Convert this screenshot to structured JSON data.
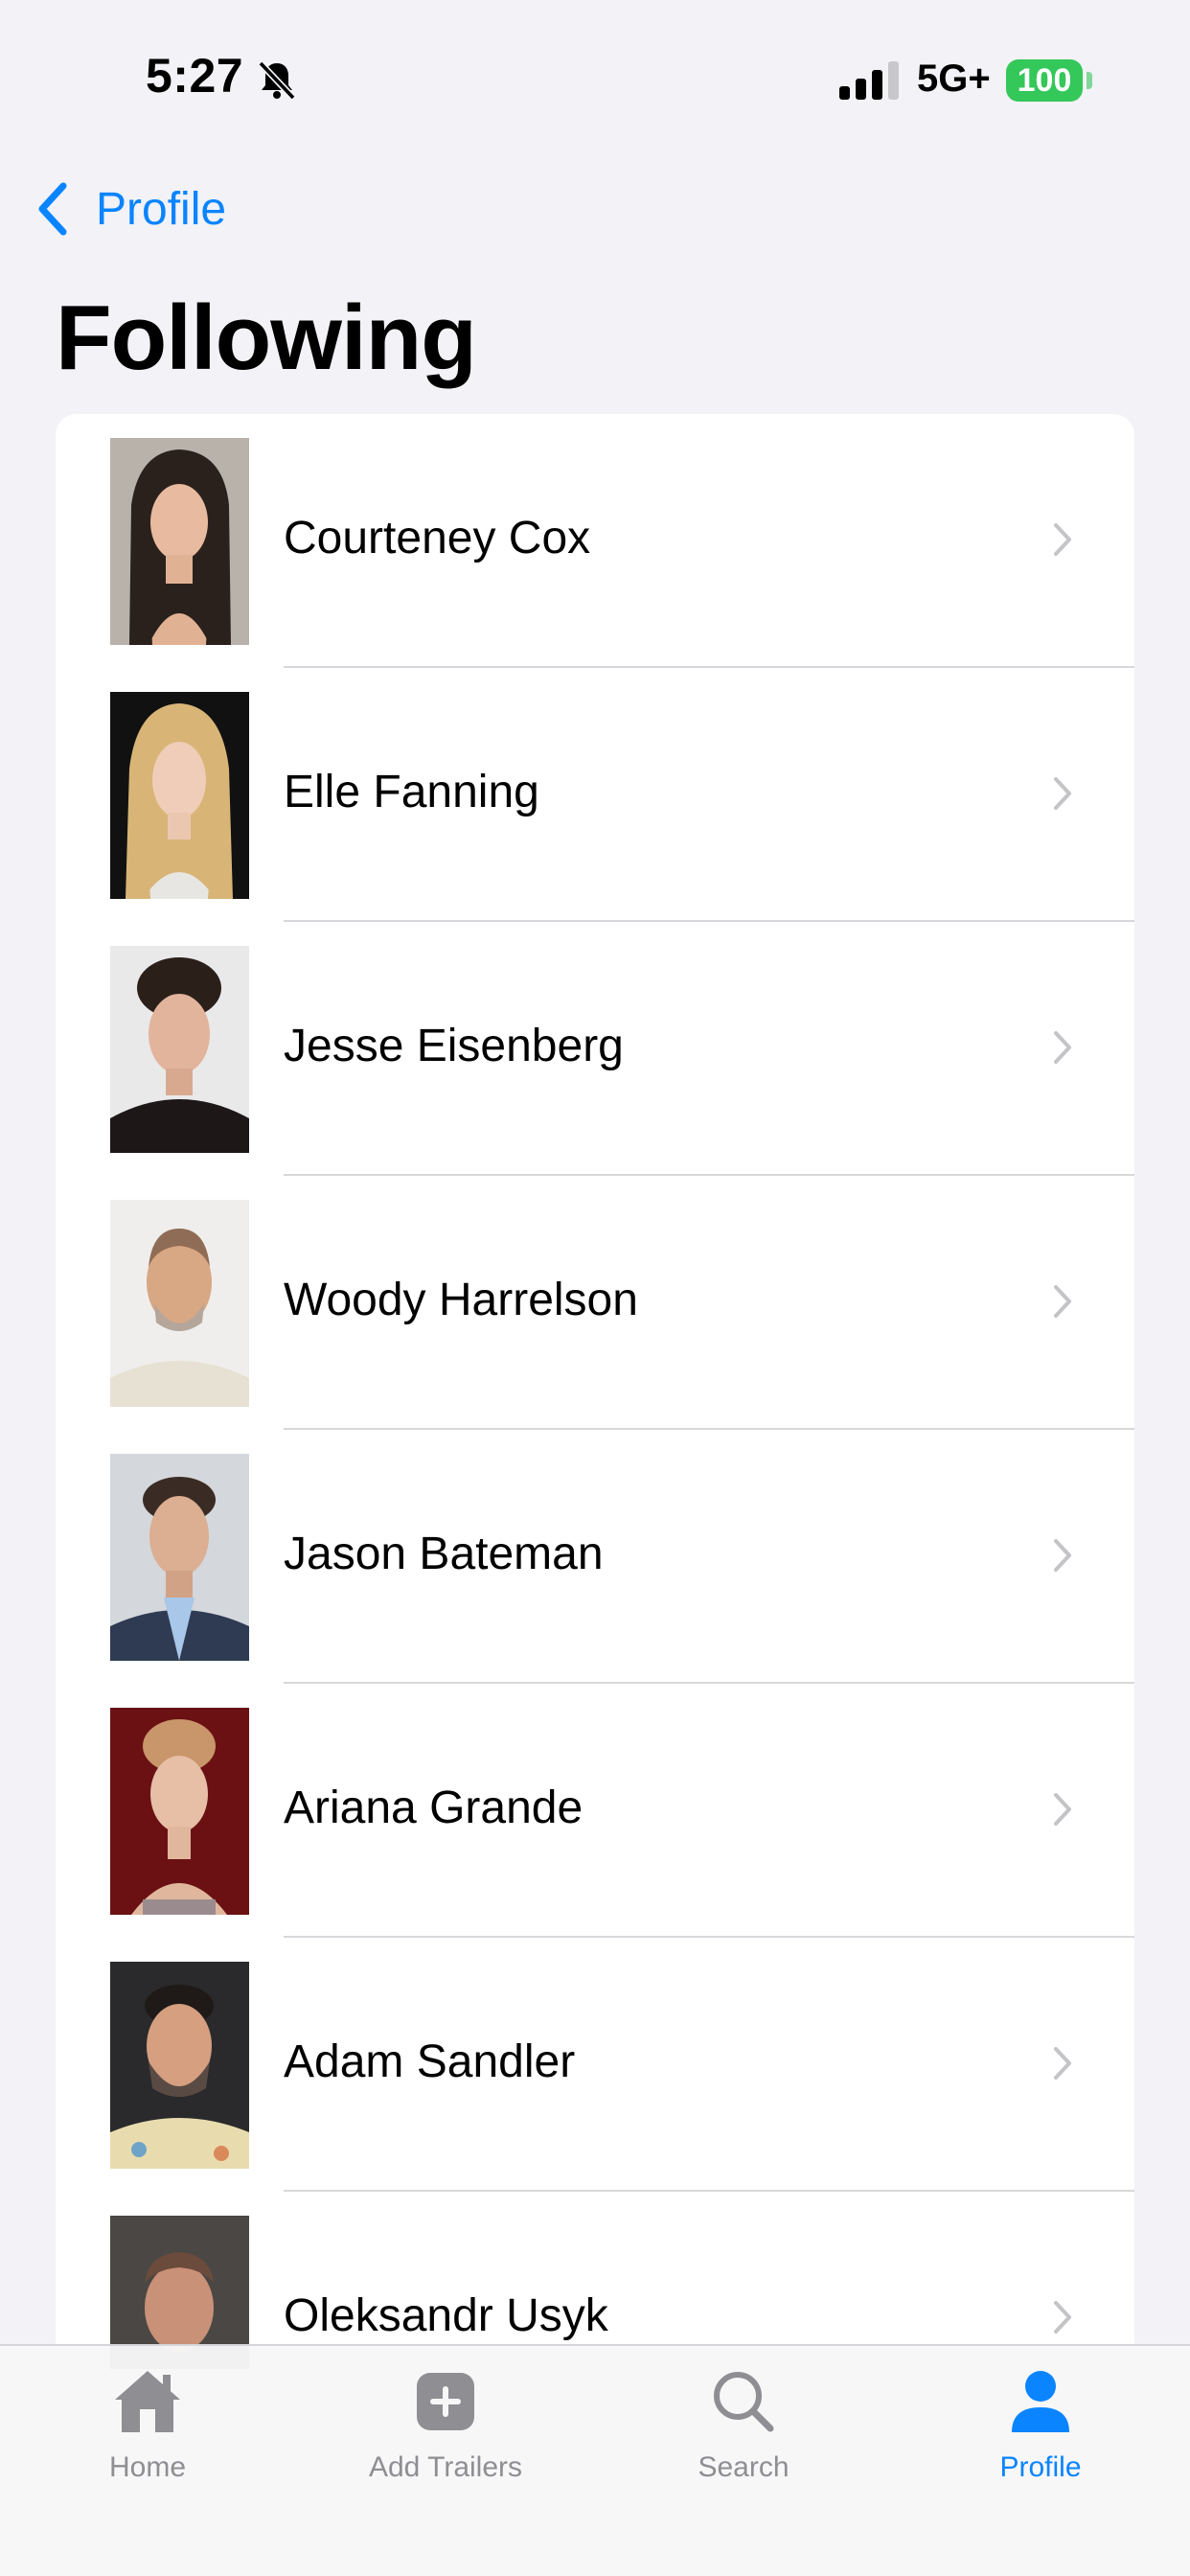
{
  "status_bar": {
    "time": "5:27",
    "network": "5G+",
    "battery": "100"
  },
  "nav": {
    "back_label": "Profile",
    "title": "Following"
  },
  "following": [
    {
      "name": "Courteney Cox"
    },
    {
      "name": "Elle Fanning"
    },
    {
      "name": "Jesse Eisenberg"
    },
    {
      "name": "Woody Harrelson"
    },
    {
      "name": "Jason Bateman"
    },
    {
      "name": "Ariana Grande"
    },
    {
      "name": "Adam Sandler"
    },
    {
      "name": "Oleksandr Usyk"
    }
  ],
  "tab_bar": {
    "tabs": [
      {
        "label": "Home",
        "icon": "house-icon"
      },
      {
        "label": "Add Trailers",
        "icon": "plus-square-icon"
      },
      {
        "label": "Search",
        "icon": "magnifying-glass-icon"
      },
      {
        "label": "Profile",
        "icon": "person-icon"
      }
    ],
    "active": "Profile"
  },
  "colors": {
    "accent": "#0a84ff",
    "battery": "#34c759",
    "background": "#f2f2f7"
  }
}
